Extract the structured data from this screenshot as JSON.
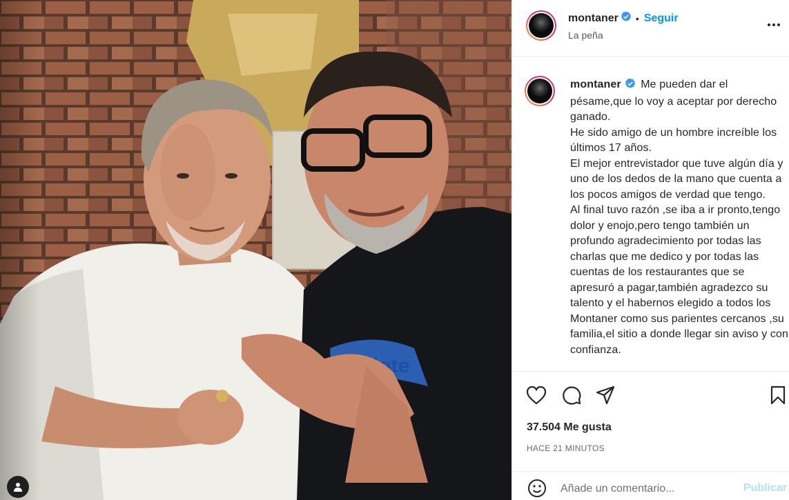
{
  "post": {
    "username": "montaner",
    "location": "La peña",
    "follow_label": "Seguir",
    "separator": "•"
  },
  "caption": {
    "username": "montaner",
    "text": "Me pueden dar el pésame,que lo voy a aceptar por derecho ganado.\nHe sido amigo de un hombre increíble los últimos 17 años.\nEl mejor entrevistador que tuve algún día y uno de los dedos de la mano que cuenta a los pocos amigos de verdad que tengo.\nAl final tuvo razón ,se iba a ir pronto,tengo dolor y enojo,pero tengo también un profundo agradecimiento por todas las charlas que me dedico y por todas las cuentas de los restaurantes que se apresuró a pagar,también agradezco su talento y el habernos elegido a todos los Montaner como sus parientes cercanos ,su familia,el sitio a donde llegar sin aviso y con confianza."
  },
  "stats": {
    "likes": "37.504 Me gusta",
    "timestamp": "HACE 21 MINUTOS"
  },
  "comment": {
    "placeholder": "Añade un comentario...",
    "publish_label": "Publicar"
  },
  "photo": {
    "shirt_text": "lote"
  },
  "colors": {
    "accent": "#0095f6",
    "publish_disabled": "#b2dffc",
    "verified": "#3897f0",
    "border": "#efefef"
  },
  "icons": {
    "like": "heart-icon",
    "comment": "comment-icon",
    "share": "paper-plane-icon",
    "save": "bookmark-icon",
    "more": "more-options-icon",
    "emoji": "smiley-icon",
    "tag": "user-tag-icon",
    "verified": "verified-badge-icon"
  }
}
